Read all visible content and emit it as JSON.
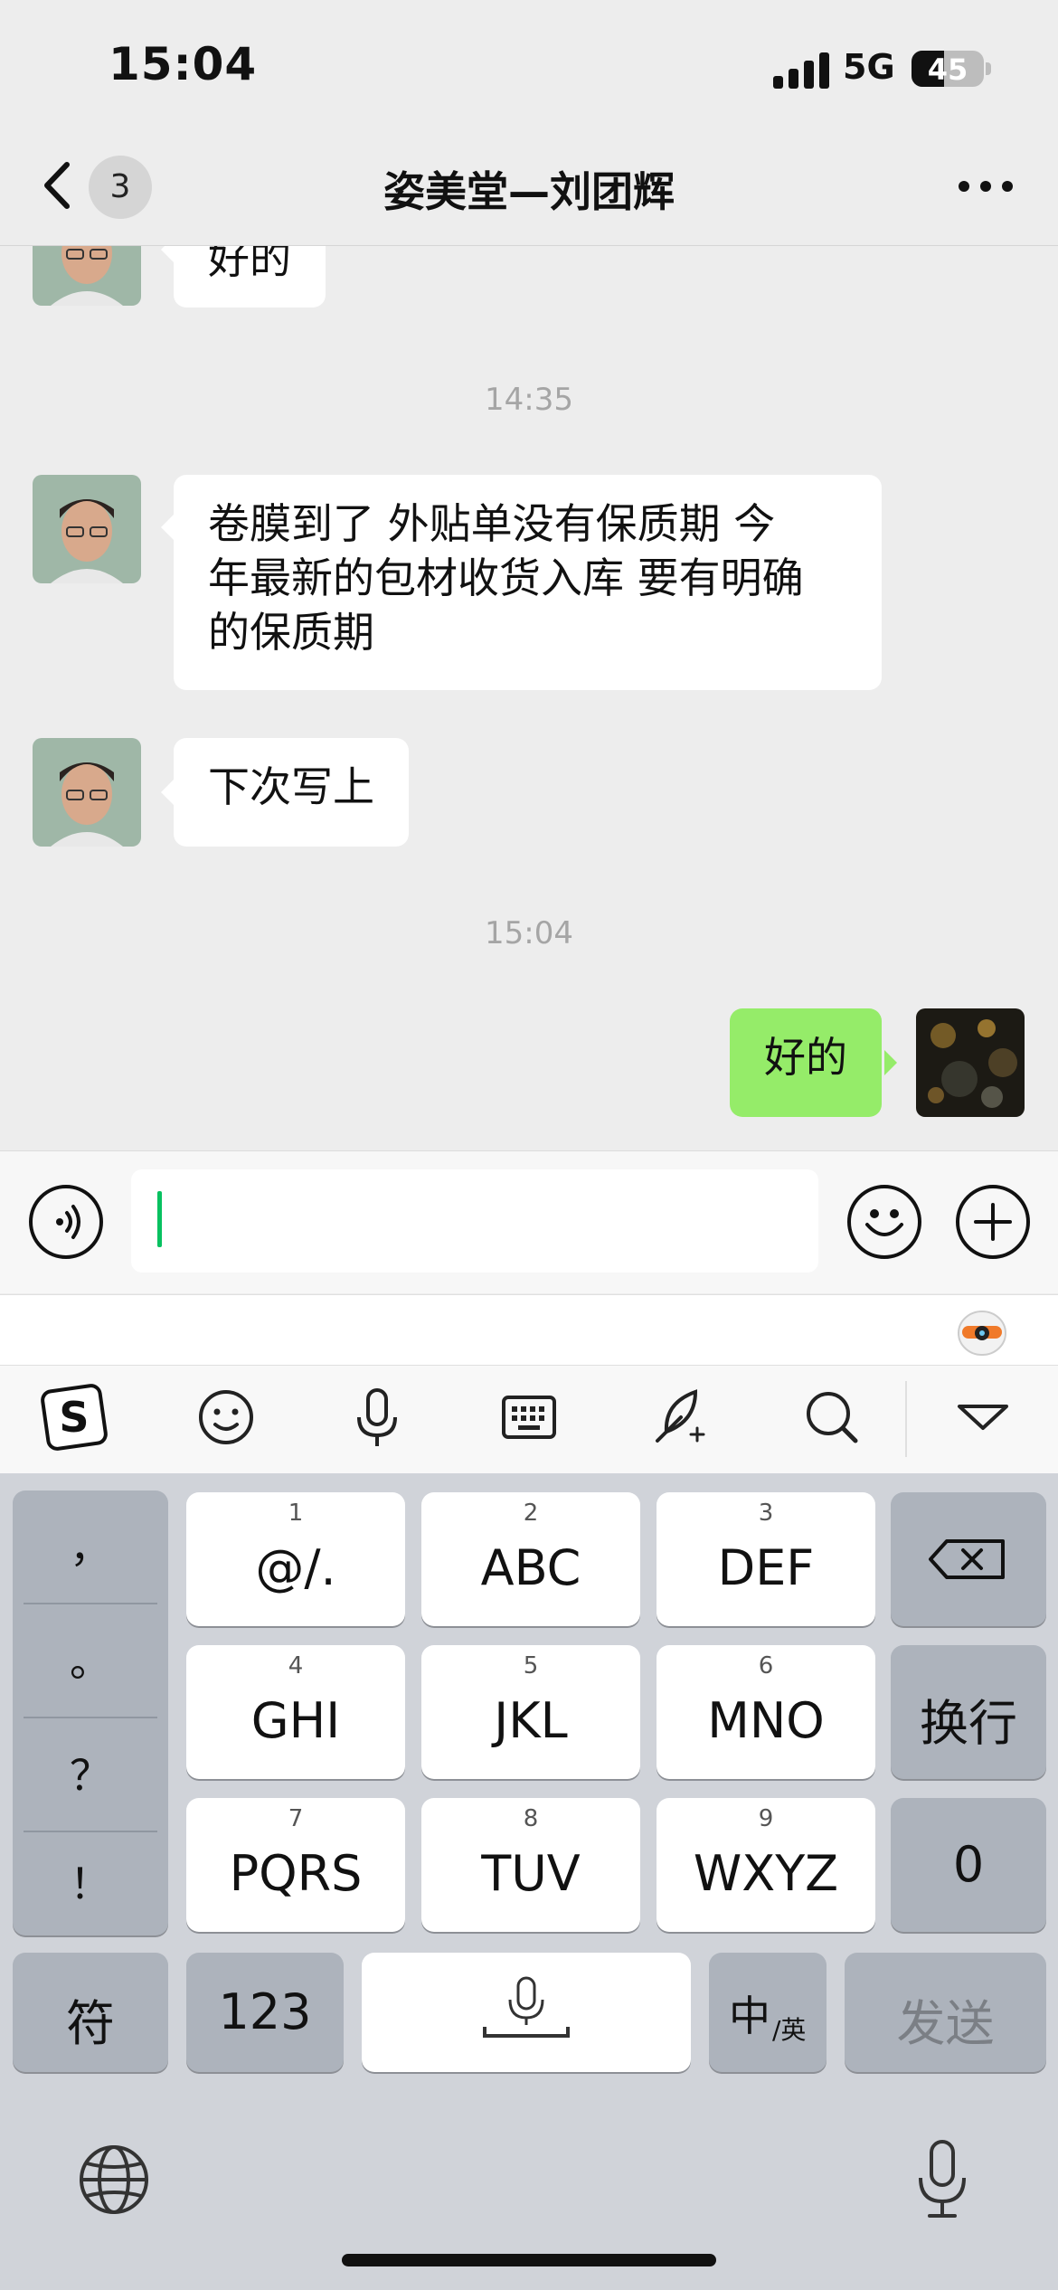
{
  "status_bar": {
    "time": "15:04",
    "network": "5G",
    "battery": "45",
    "battery_level": 0.45
  },
  "nav": {
    "unread_count": "3",
    "title": "姿美堂—刘团辉"
  },
  "messages": [
    {
      "side": "left",
      "text": "好的"
    },
    {
      "type": "time",
      "text": "14:35"
    },
    {
      "side": "left",
      "lines": [
        "卷膜到了  外贴单没有保质期   今",
        "年最新的包材收货入库  要有明确",
        "的保质期"
      ]
    },
    {
      "side": "left",
      "text": "下次写上"
    },
    {
      "type": "time",
      "text": "15:04"
    },
    {
      "side": "right",
      "text": "好的"
    }
  ],
  "input": {
    "value": ""
  },
  "icons": {
    "back": "chevron-left-icon",
    "more": "more-dots-icon",
    "voice": "voice-wave-icon",
    "emoji": "smiley-icon",
    "plus": "plus-icon",
    "ime_logo": "sogou-logo-icon",
    "mic": "microphone-icon",
    "keyboard": "keyboard-icon",
    "handwrite": "quill-icon",
    "search": "search-icon",
    "collapse": "triangle-down-icon",
    "globe": "globe-icon"
  },
  "keyboard": {
    "punctuation": [
      "，",
      "。",
      "？",
      "！"
    ],
    "keys": [
      {
        "num": "1",
        "label": "@/."
      },
      {
        "num": "2",
        "label": "ABC"
      },
      {
        "num": "3",
        "label": "DEF"
      },
      {
        "num": "4",
        "label": "GHI"
      },
      {
        "num": "5",
        "label": "JKL"
      },
      {
        "num": "6",
        "label": "MNO"
      },
      {
        "num": "7",
        "label": "PQRS"
      },
      {
        "num": "8",
        "label": "TUV"
      },
      {
        "num": "9",
        "label": "WXYZ"
      }
    ],
    "newline": "换行",
    "zero": "0",
    "symbol": "符",
    "numeric": "123",
    "lang_main": "中",
    "lang_sub": "/英",
    "send": "发送"
  },
  "colors": {
    "accent": "#07c160",
    "outgoing_bubble": "#95ec69",
    "background": "#ededed"
  }
}
